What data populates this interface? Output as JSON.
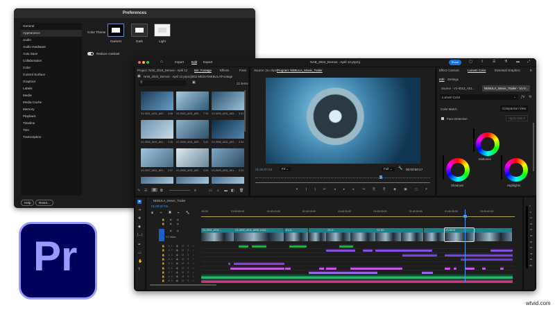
{
  "preferences": {
    "title": "Preferences",
    "sidebar": [
      "General",
      "Appearance",
      "Audio",
      "Audio Hardware",
      "Auto Save",
      "Collaboration",
      "Color",
      "Control Surface",
      "Graphics",
      "Labels",
      "Media",
      "Media Cache",
      "Memory",
      "Playback",
      "Timeline",
      "Trim",
      "Transcription"
    ],
    "selected": "Appearance",
    "color_theme_label": "Color Theme",
    "themes": [
      "Darkest",
      "Dark",
      "Light"
    ],
    "selected_theme": "Darkest",
    "reduce_contrast_label": "Reduce contrast",
    "reduce_contrast_on": true,
    "help_button": "Help",
    "reset_button": "Reset..."
  },
  "logo": {
    "text": "Pr",
    "bg": "#00005b",
    "fg": "#9999ff"
  },
  "watermark": "wtvid.com",
  "app": {
    "title": "NAB_2024_Demos - April 12.prproj",
    "nav": [
      "Import",
      "Edit",
      "Export"
    ],
    "active_nav": "Edit",
    "share_button": "Share",
    "accent": "#1473e6",
    "project": {
      "tabs": [
        "Project: NAB_2024_Demos - April 12",
        "Bin: Footage",
        "Effects",
        "Fram"
      ],
      "path": "NAB_2024_Demos - April 12.prproj\\002 MEDIA\\NEBULA\\Footage",
      "search_placeholder": "",
      "item_count": "21 items",
      "clips": [
        {
          "name": "V1-0001_A011_A02...",
          "dur": "3.08"
        },
        {
          "name": "V1-0002_A011_A05...",
          "dur": "7.10"
        },
        {
          "name": "V1-0003_A011_A02...",
          "dur": "3.24"
        },
        {
          "name": "V1-0004_A011_A01...",
          "dur": "2.25"
        },
        {
          "name": "V1-0005_A011_A05...",
          "dur": "3.21"
        },
        {
          "name": "V1-0006_A011_A02...",
          "dur": "2.03"
        },
        {
          "name": "V1-0007_A011_A01...",
          "dur": "2.07"
        },
        {
          "name": "V1-0008_A011_A02...",
          "dur": "3.29"
        },
        {
          "name": "V1-0009_A011_A01...",
          "dur": "2.24"
        }
      ]
    },
    "monitor": {
      "tabs": [
        "Source: (no clips)",
        "Program: NEBULA_Movie_Trailer"
      ],
      "timecode": "01:00:37:02",
      "fit": "Fit",
      "quality": "Full",
      "duration": "00:00:50:17"
    },
    "lumetri": {
      "tabs": [
        "Effect Controls",
        "Lumetri Color",
        "Essential Graphics",
        "E"
      ],
      "subtabs": [
        "Edit",
        "Settings"
      ],
      "source": "Source - V1-0013_A01...",
      "sequence_clip": "NEBULA_Movie_Trailer - V1-0...",
      "effect": "Lumetri Color",
      "color_match": "Color Match",
      "comparison_view": "Comparison View",
      "face_detection": "Face Detection",
      "face_detection_checked": true,
      "apply_match": "Apply Match",
      "wheels": [
        "Midtones",
        "Shadows",
        "Highlights"
      ]
    },
    "timeline": {
      "sequence": "NEBULA_Movie_Trailer",
      "timecode": "01:00:37:02",
      "ruler": [
        ":00:00",
        "01:00:05:00",
        "01:00:10:00",
        "01:00:15:00",
        "01:00:20:00",
        "01:00:25:00",
        "01:00:30:00",
        "01:00:35:00",
        "01:00:40:00"
      ],
      "v1_label": "V1 Video",
      "video_tracks": [
        "V3",
        "V2",
        "V1"
      ],
      "audio_tracks": [
        "A1",
        "A2",
        "A3",
        "A4",
        "A5",
        "A6",
        "A7",
        "A8",
        "A9"
      ],
      "meter_scale": [
        "0",
        "-6",
        "-12",
        "-18",
        "-24",
        "-30",
        "-36",
        "-42",
        "-48",
        "-54",
        "dB"
      ],
      "playhead_sec": 37.1,
      "video_clips": [
        {
          "name": "V1-0001_A011...",
          "start": 0,
          "end": 4.6
        },
        {
          "name": "V1-0002_A011_A005_0122...",
          "start": 4.6,
          "end": 11.7
        },
        {
          "name": "V1-A...",
          "start": 11.7,
          "end": 15.1
        },
        {
          "name": "",
          "start": 15.1,
          "end": 17.6
        },
        {
          "name": "V1-0...",
          "start": 17.6,
          "end": 21
        },
        {
          "name": "",
          "start": 21,
          "end": 24.5
        },
        {
          "name": "V1-00...",
          "start": 24.5,
          "end": 28.1
        },
        {
          "name": "",
          "start": 28.1,
          "end": 31.3
        },
        {
          "name": "",
          "start": 31.3,
          "end": 34.2
        },
        {
          "name": "V1-0013",
          "start": 34.2,
          "end": 38.4,
          "selected": true
        },
        {
          "name": "",
          "start": 38.4,
          "end": 43.8
        }
      ],
      "audio_clips": [
        {
          "track": 0,
          "color": "#22b53a",
          "clips": [
            [
              5.3,
              6.6
            ],
            [
              7.1,
              9.2
            ],
            [
              12.4,
              14.8
            ],
            [
              19.4,
              21.4
            ]
          ]
        },
        {
          "track": 1,
          "color": "#8a55e8",
          "clips": [
            [
              17.6,
              21.7
            ],
            [
              22.7,
              24.1
            ],
            [
              24.5,
              32.5
            ],
            [
              40.7,
              43.8
            ]
          ]
        },
        {
          "track": 2,
          "color": "#7b46e0",
          "clips": [
            [
              28.3,
              33.2
            ],
            [
              34.2,
              43.8
            ]
          ]
        },
        {
          "track": 3,
          "color": "#6a3fd8",
          "clips": [
            [
              36.5,
              43.8
            ]
          ]
        },
        {
          "track": 4,
          "color": "#9b3fe0",
          "clips": [
            [
              3.8,
              4.1
            ],
            [
              4.6,
              11.7
            ]
          ]
        },
        {
          "track": 5,
          "color": "#d15ae8",
          "clips": [
            [
              4.1,
              11.7
            ],
            [
              11.8,
              12.6
            ],
            [
              16.6,
              17.3
            ],
            [
              17.6,
              19
            ],
            [
              21,
              28.3
            ],
            [
              34.2,
              35
            ],
            [
              35.5,
              35.9
            ],
            [
              37.2,
              38.4
            ],
            [
              39.5,
              40
            ],
            [
              42,
              42.5
            ]
          ]
        },
        {
          "track": 6,
          "color": "#a26cf0",
          "clips": [
            [
              15.1,
              24.8
            ],
            [
              31,
              32.6
            ]
          ]
        },
        {
          "track": 7,
          "color": "#1fb86a",
          "clips": [
            [
              0,
              43.8
            ]
          ]
        },
        {
          "track": 8,
          "color": "#d6307f",
          "clips": [
            [
              0,
              43.8
            ]
          ]
        }
      ]
    }
  }
}
